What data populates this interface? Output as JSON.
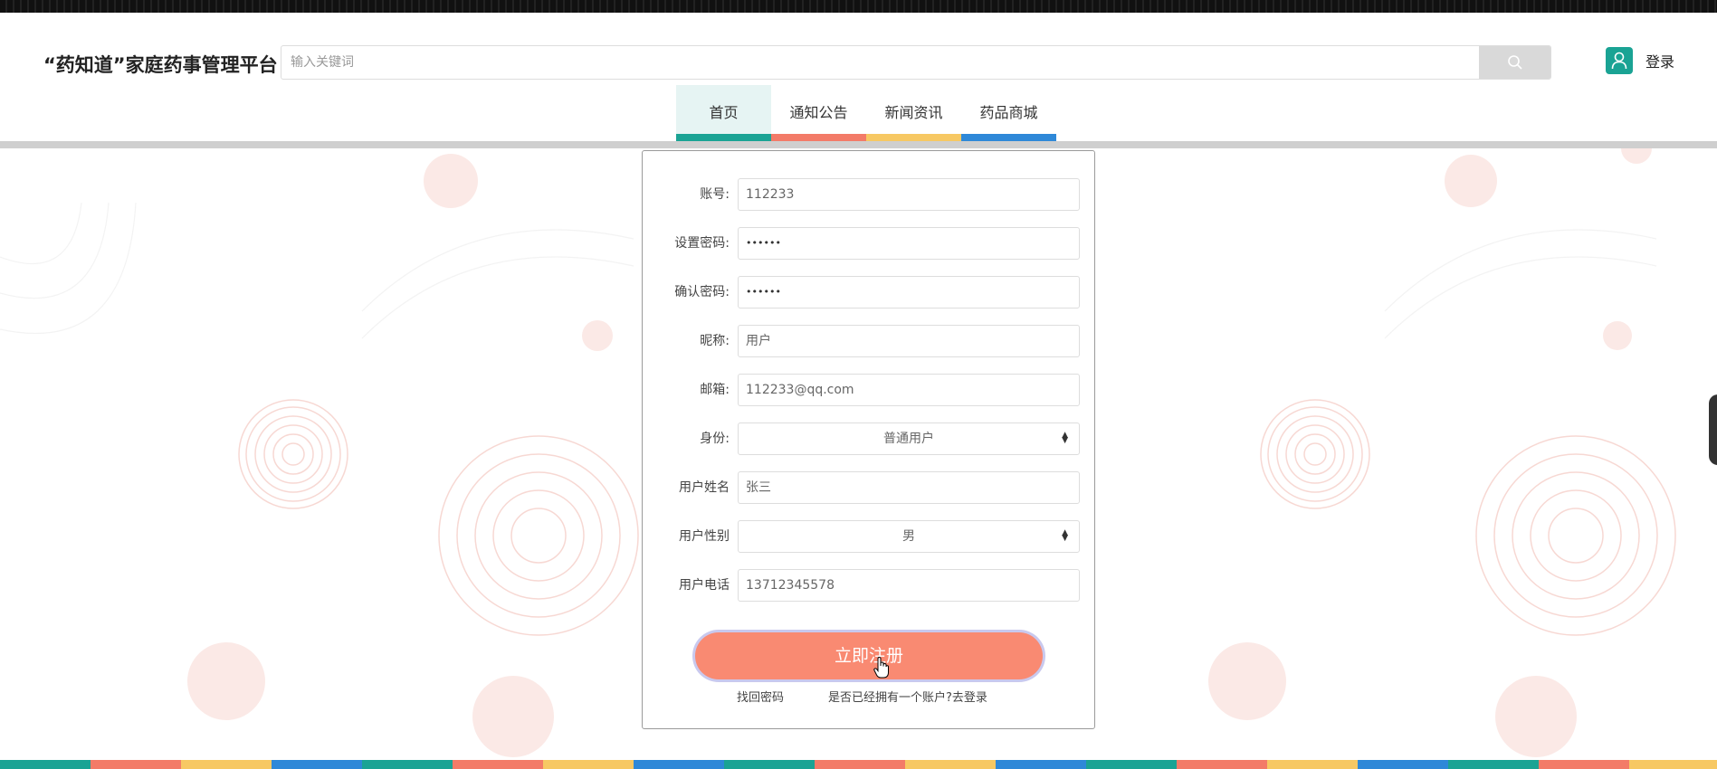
{
  "header": {
    "brand": "“药知道”家庭药事管理平台",
    "search_placeholder": "输入关键词",
    "login_label": "登录"
  },
  "nav": {
    "items": [
      {
        "label": "首页",
        "color": "#1aa394"
      },
      {
        "label": "通知公告",
        "color": "#f37b68"
      },
      {
        "label": "新闻资讯",
        "color": "#f7c863"
      },
      {
        "label": "药品商城",
        "color": "#2e88d8"
      }
    ]
  },
  "form": {
    "fields": [
      {
        "label": "账号:",
        "value": "112233"
      },
      {
        "label": "设置密码:",
        "value": "••••••"
      },
      {
        "label": "确认密码:",
        "value": "••••••"
      },
      {
        "label": "昵称:",
        "value": "用户"
      },
      {
        "label": "邮箱:",
        "value": "112233@qq.com"
      },
      {
        "label": "身份:",
        "value": "普通用户"
      },
      {
        "label": "用户姓名",
        "value": "张三"
      },
      {
        "label": "用户性别",
        "value": "男"
      },
      {
        "label": "用户电话",
        "value": "13712345578"
      }
    ],
    "submit_label": "立即注册",
    "forgot_label": "找回密码",
    "login_link_label": "是否已经拥有一个账户?去登录"
  },
  "colors": {
    "accent_teal": "#1aa394",
    "accent_red": "#f37b68",
    "accent_yellow": "#f7c863",
    "accent_blue": "#2e88d8",
    "submit": "#f98a72"
  }
}
